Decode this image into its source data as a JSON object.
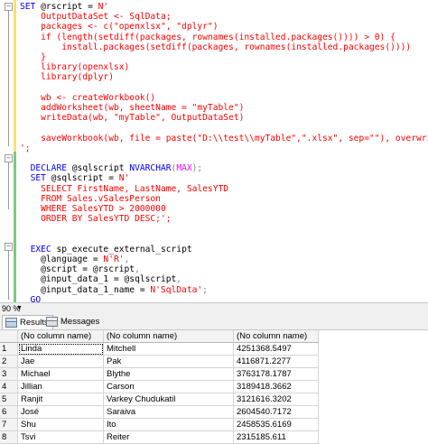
{
  "editor": {
    "lines": [
      [
        [
          "kw",
          "SET "
        ],
        [
          "var",
          "@rscript = "
        ],
        [
          "str",
          "N'"
        ]
      ],
      [
        [
          "str",
          "    OutputDataSet <- SqlData;"
        ]
      ],
      [
        [
          "str",
          "    packages <- c(\"openxlsx\", \"dplyr\")"
        ]
      ],
      [
        [
          "str",
          "    if (length(setdiff(packages, rownames(installed.packages()))) > 0) {"
        ]
      ],
      [
        [
          "str",
          "        install.packages(setdiff(packages, rownames(installed.packages())))"
        ]
      ],
      [
        [
          "str",
          "    }"
        ]
      ],
      [
        [
          "str",
          "    library(openxlsx)"
        ]
      ],
      [
        [
          "str",
          "    library(dplyr)"
        ]
      ],
      [
        [
          "str",
          ""
        ]
      ],
      [
        [
          "str",
          "    wb <- createWorkbook()"
        ]
      ],
      [
        [
          "str",
          "    addWorksheet(wb, sheetName = \"myTable\")"
        ]
      ],
      [
        [
          "str",
          "    writeData(wb, \"myTable\", OutputDataSet)"
        ]
      ],
      [
        [
          "str",
          ""
        ]
      ],
      [
        [
          "str",
          "    saveWorkbook(wb, file = paste(\"D:\\\\test\\\\myTable\",\".xlsx\", sep=\"\"), overwrite = TRUE)"
        ]
      ],
      [
        [
          "str",
          "';"
        ]
      ],
      [
        [
          "str",
          ""
        ]
      ],
      [
        [
          "var",
          "  "
        ],
        [
          "kw",
          "DECLARE "
        ],
        [
          "var",
          "@sqlscript "
        ],
        [
          "kw",
          "NVARCHAR"
        ],
        [
          "gry",
          "("
        ],
        [
          "fn",
          "MAX"
        ],
        [
          "gry",
          ");"
        ]
      ],
      [
        [
          "var",
          "  "
        ],
        [
          "kw",
          "SET "
        ],
        [
          "var",
          "@sqlscript = "
        ],
        [
          "str",
          "N'"
        ]
      ],
      [
        [
          "str",
          "    SELECT FirstName, LastName, SalesYTD"
        ]
      ],
      [
        [
          "str",
          "    FROM Sales.vSalesPerson"
        ]
      ],
      [
        [
          "str",
          "    WHERE SalesYTD > 2000000"
        ]
      ],
      [
        [
          "str",
          "    ORDER BY SalesYTD DESC;';"
        ]
      ],
      [
        [
          "str",
          ""
        ]
      ],
      [
        [
          "str",
          ""
        ]
      ],
      [
        [
          "var",
          "  "
        ],
        [
          "kw",
          "EXEC "
        ],
        [
          "var",
          "sp_execute_external_script"
        ]
      ],
      [
        [
          "var",
          "    @language = "
        ],
        [
          "str",
          "N'R'"
        ],
        [
          "gry",
          ","
        ]
      ],
      [
        [
          "var",
          "    @script = @rscript"
        ],
        [
          "gry",
          ","
        ]
      ],
      [
        [
          "var",
          "    @input_data_1 = @sqlscript"
        ],
        [
          "gry",
          ","
        ]
      ],
      [
        [
          "var",
          "    @input_data_1_name = "
        ],
        [
          "str",
          "N'SqlData'"
        ],
        [
          "gry",
          ";"
        ]
      ],
      [
        [
          "kw",
          "  GO"
        ]
      ]
    ]
  },
  "zoom": {
    "value": "90 %"
  },
  "tabs": [
    {
      "label": "Results",
      "active": true
    },
    {
      "label": "Messages",
      "active": false
    }
  ],
  "results": {
    "headers": [
      "(No column name)",
      "(No column name)",
      "(No column name)"
    ],
    "rows": [
      [
        "1",
        "Linda",
        "Mitchell",
        "4251368.5497"
      ],
      [
        "2",
        "Jae",
        "Pak",
        "4116871.2277"
      ],
      [
        "3",
        "Michael",
        "Blythe",
        "3763178.1787"
      ],
      [
        "4",
        "Jillian",
        "Carson",
        "3189418.3662"
      ],
      [
        "5",
        "Ranjit",
        "Varkey Chudukatil",
        "3121616.3202"
      ],
      [
        "6",
        "José",
        "Saraiva",
        "2604540.7172"
      ],
      [
        "7",
        "Shu",
        "Ito",
        "2458535.6169"
      ],
      [
        "8",
        "Tsvi",
        "Reiter",
        "2315185.611"
      ]
    ]
  }
}
